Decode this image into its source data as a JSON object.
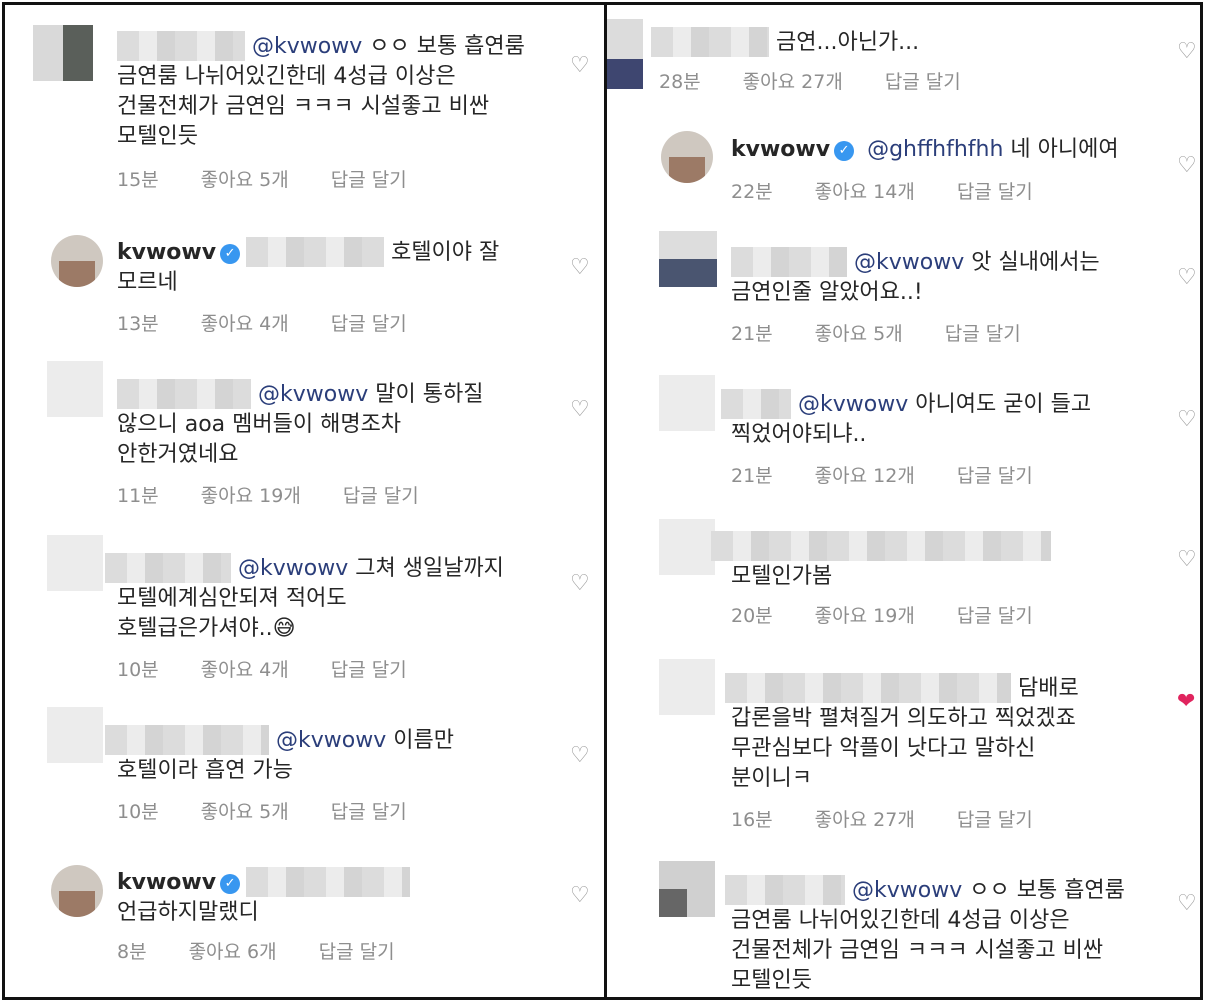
{
  "colors": {
    "mention": "#2b3e7a",
    "meta": "#8e8e8e",
    "liked_heart": "#e0245e",
    "verified": "#3897f0"
  },
  "icons": {
    "like": "heart-outline-icon",
    "liked": "heart-filled-icon",
    "verified": "verified-badge-icon"
  },
  "left": [
    {
      "mention": "@kvwowv",
      "lines": [
        "ㅇㅇ 보통 흡연룸",
        "금연룸 나뉘어있긴한데 4성급 이상은",
        "건물전체가 금연임 ㅋㅋㅋ 시설좋고 비싼",
        "모텔인듯"
      ],
      "time": "15분",
      "likes": "좋아요 5개",
      "reply": "답글 달기",
      "liked": false
    },
    {
      "user": "kvwowv",
      "verified": true,
      "lines": [
        "호텔이야 잘",
        "모르네"
      ],
      "time": "13분",
      "likes": "좋아요 4개",
      "reply": "답글 달기",
      "liked": false
    },
    {
      "mention": "@kvwowv",
      "lines": [
        "말이 통하질",
        "않으니 aoa 멤버들이 해명조차",
        "안한거였네요"
      ],
      "time": "11분",
      "likes": "좋아요 19개",
      "reply": "답글 달기",
      "liked": false
    },
    {
      "mention": "@kvwowv",
      "lines": [
        "그쳐 생일날까지",
        "모텔에계심안되져 적어도",
        "호텔급은가셔야..😅"
      ],
      "time": "10분",
      "likes": "좋아요 4개",
      "reply": "답글 달기",
      "liked": false
    },
    {
      "mention": "@kvwowv",
      "lines": [
        "이름만",
        "호텔이라 흡연  가능"
      ],
      "time": "10분",
      "likes": "좋아요 5개",
      "reply": "답글 달기",
      "liked": false
    },
    {
      "user": "kvwowv",
      "verified": true,
      "lines": [
        "",
        "언급하지말랬디"
      ],
      "time": "8분",
      "likes": "좋아요 6개",
      "reply": "답글 달기",
      "liked": false
    }
  ],
  "right": [
    {
      "lines": [
        "금연...아닌가..."
      ],
      "time": "28분",
      "likes": "좋아요 27개",
      "reply": "답글 달기",
      "liked": false
    },
    {
      "user": "kvwowv",
      "verified": true,
      "mention": "@ghffhfhfhh",
      "lines": [
        "네 아니에여"
      ],
      "time": "22분",
      "likes": "좋아요 14개",
      "reply": "답글 달기",
      "liked": false
    },
    {
      "mention": "@kvwowv",
      "lines": [
        "앗 실내에서는",
        "금연인줄 알았어요..!"
      ],
      "time": "21분",
      "likes": "좋아요 5개",
      "reply": "답글 달기",
      "liked": false
    },
    {
      "mention": "@kvwowv",
      "lines": [
        "아니여도 굳이 들고",
        "찍었어야되냐.."
      ],
      "time": "21분",
      "likes": "좋아요 12개",
      "reply": "답글 달기",
      "liked": false
    },
    {
      "lines": [
        "",
        "모텔인가봄"
      ],
      "time": "20분",
      "likes": "좋아요 19개",
      "reply": "답글 달기",
      "liked": false
    },
    {
      "lines": [
        "담배로",
        "갑론을박 펼쳐질거 의도하고 찍었겠죠",
        "무관심보다 악플이 낫다고 말하신",
        "분이니ㅋ"
      ],
      "time": "16분",
      "likes": "좋아요 27개",
      "reply": "답글 달기",
      "liked": true
    },
    {
      "mention": "@kvwowv",
      "lines": [
        "ㅇㅇ 보통 흡연룸",
        "금연룸 나뉘어있긴한데 4성급 이상은",
        "건물전체가 금연임 ㅋㅋㅋ 시설좋고 비싼",
        "모텔인듯"
      ],
      "time": "",
      "likes": "",
      "reply": "",
      "liked": false
    }
  ]
}
